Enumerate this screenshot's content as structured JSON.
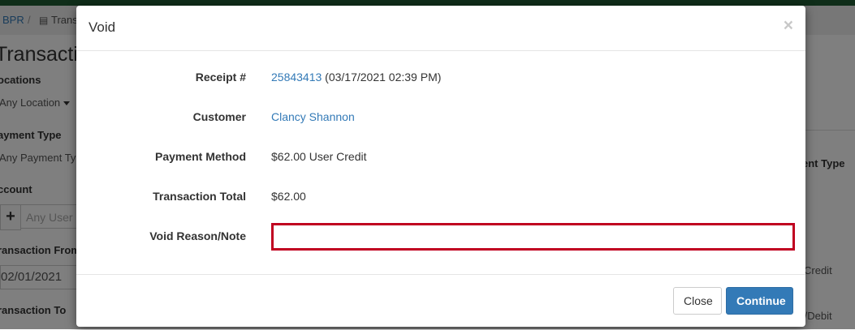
{
  "background": {
    "breadcrumb_root": "BPR",
    "breadcrumb_separator": "/",
    "breadcrumb_current": "Trans",
    "page_title": "Transactio",
    "locations_label": "ocations",
    "locations_value": "Any Location",
    "payment_type_label": "ayment Type",
    "payment_type_value": "Any Payment Ty",
    "account_label": "ccount",
    "account_plus": "+",
    "account_placeholder": "Any User",
    "transaction_from_label": "ransaction From",
    "transaction_from_value": "02/01/2021",
    "transaction_to_label": "ransaction To",
    "right_header": "ent Type",
    "right_cell_1": "Credit",
    "right_cell_2": "t/Debit"
  },
  "modal": {
    "title": "Void",
    "close_symbol": "×",
    "fields": [
      {
        "label": "Receipt #",
        "link": "25843413",
        "suffix": " (03/17/2021 02:39 PM)"
      },
      {
        "label": "Customer",
        "link": "Clancy Shannon"
      },
      {
        "label": "Payment Method",
        "value": "$62.00 User Credit"
      },
      {
        "label": "Transaction Total",
        "value": "$62.00"
      },
      {
        "label": "Void Reason/Note",
        "input_value": "",
        "input_placeholder": ""
      }
    ],
    "buttons": {
      "close_label": "Close",
      "continue_label": "Continue"
    }
  },
  "colors": {
    "primary": "#337ab7",
    "highlight_border": "#c00020",
    "topbar": "#1e5a32"
  }
}
